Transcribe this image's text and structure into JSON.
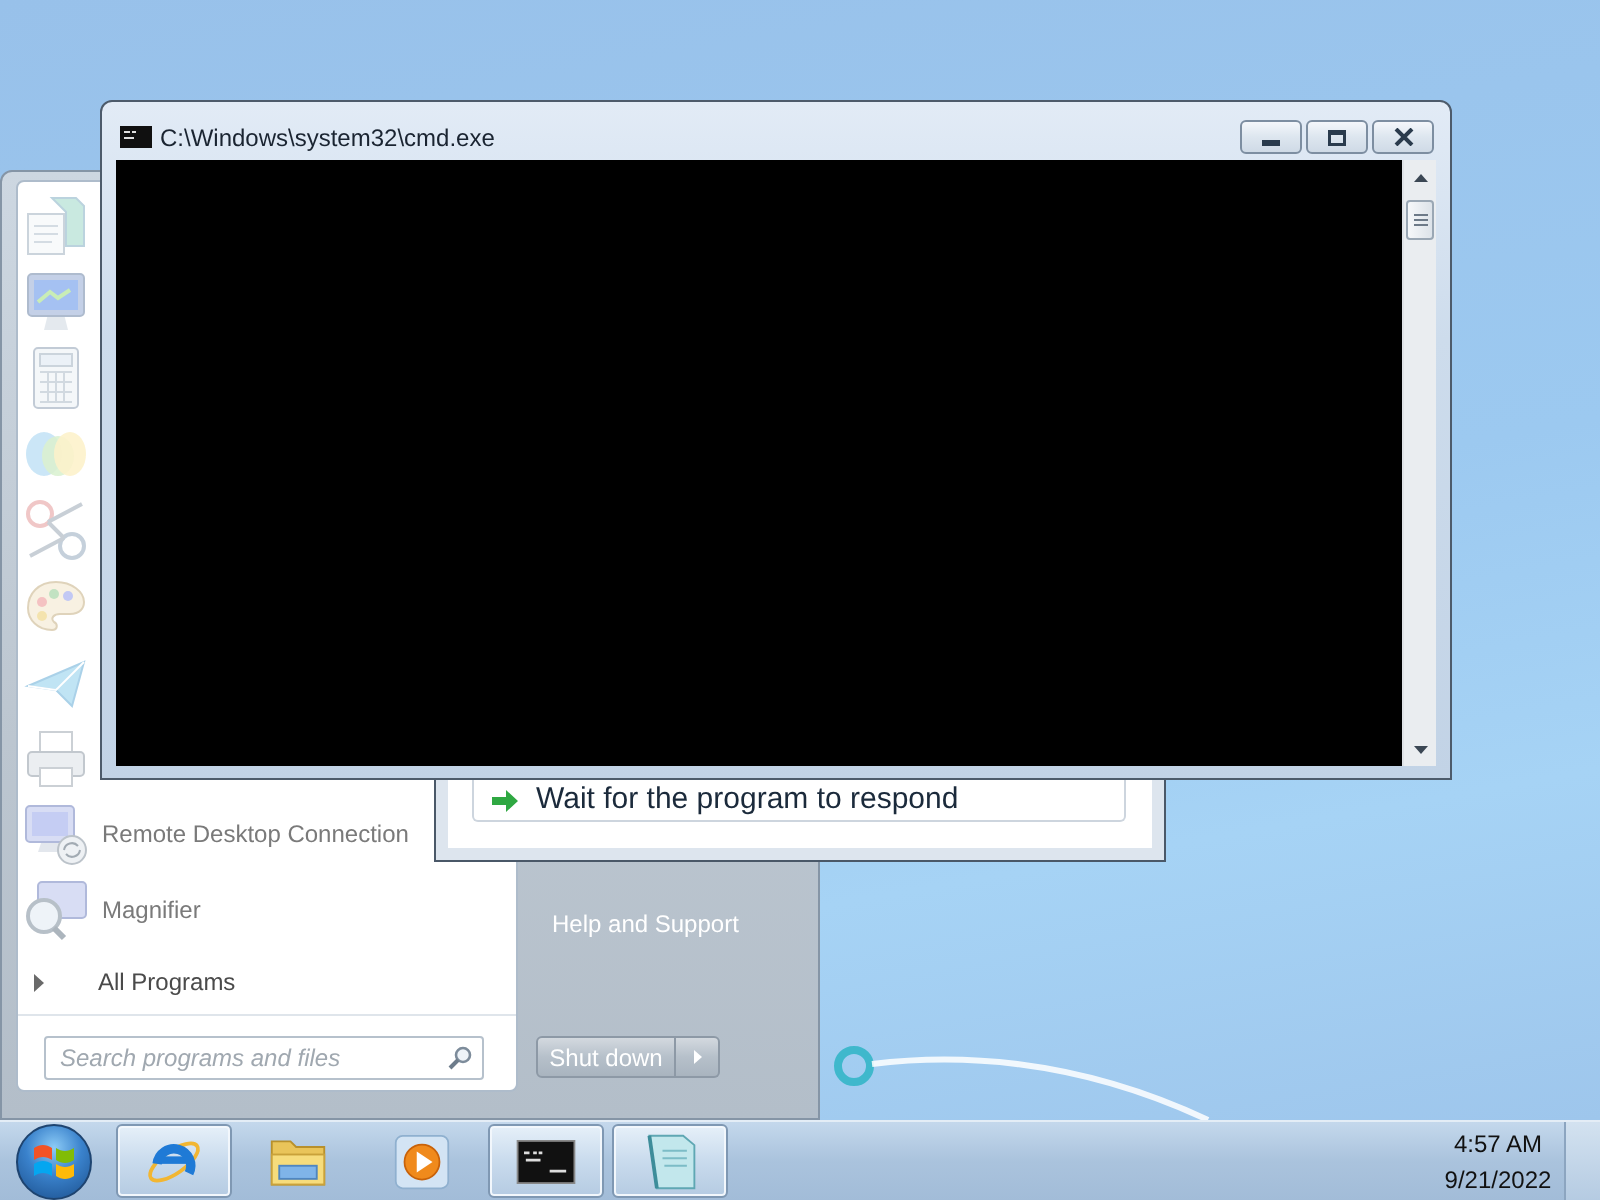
{
  "console_window": {
    "title": "C:\\Windows\\system32\\cmd.exe"
  },
  "dialog": {
    "option": "Wait for the program to respond"
  },
  "start_menu": {
    "programs": [
      {
        "label": "Remote Desktop Connection"
      },
      {
        "label": "Magnifier"
      }
    ],
    "all_programs": "All Programs",
    "search": {
      "placeholder": "Search programs and files"
    },
    "links": [
      {
        "label": "Help and Support"
      }
    ],
    "shutdown": "Shut down"
  },
  "taskbar": {
    "buttons": [
      {
        "running": true
      },
      {
        "running": false
      },
      {
        "running": false
      },
      {
        "running": true
      },
      {
        "running": true
      }
    ],
    "clock": {
      "time": "4:57 AM",
      "date": "9/21/2022"
    }
  }
}
